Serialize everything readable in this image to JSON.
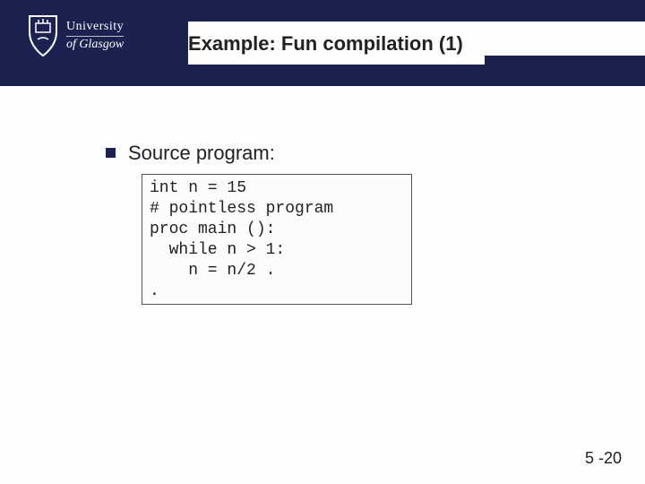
{
  "logo": {
    "line1": "University",
    "line2_prefix": "of",
    "line2_name": "Glasgow"
  },
  "title": "Example: Fun compilation (1)",
  "bullet": "Source program:",
  "code": "int n = 15\n# pointless program\nproc main ():\n  while n > 1:\n    n = n/2 .\n.",
  "page_number": "5 -20"
}
